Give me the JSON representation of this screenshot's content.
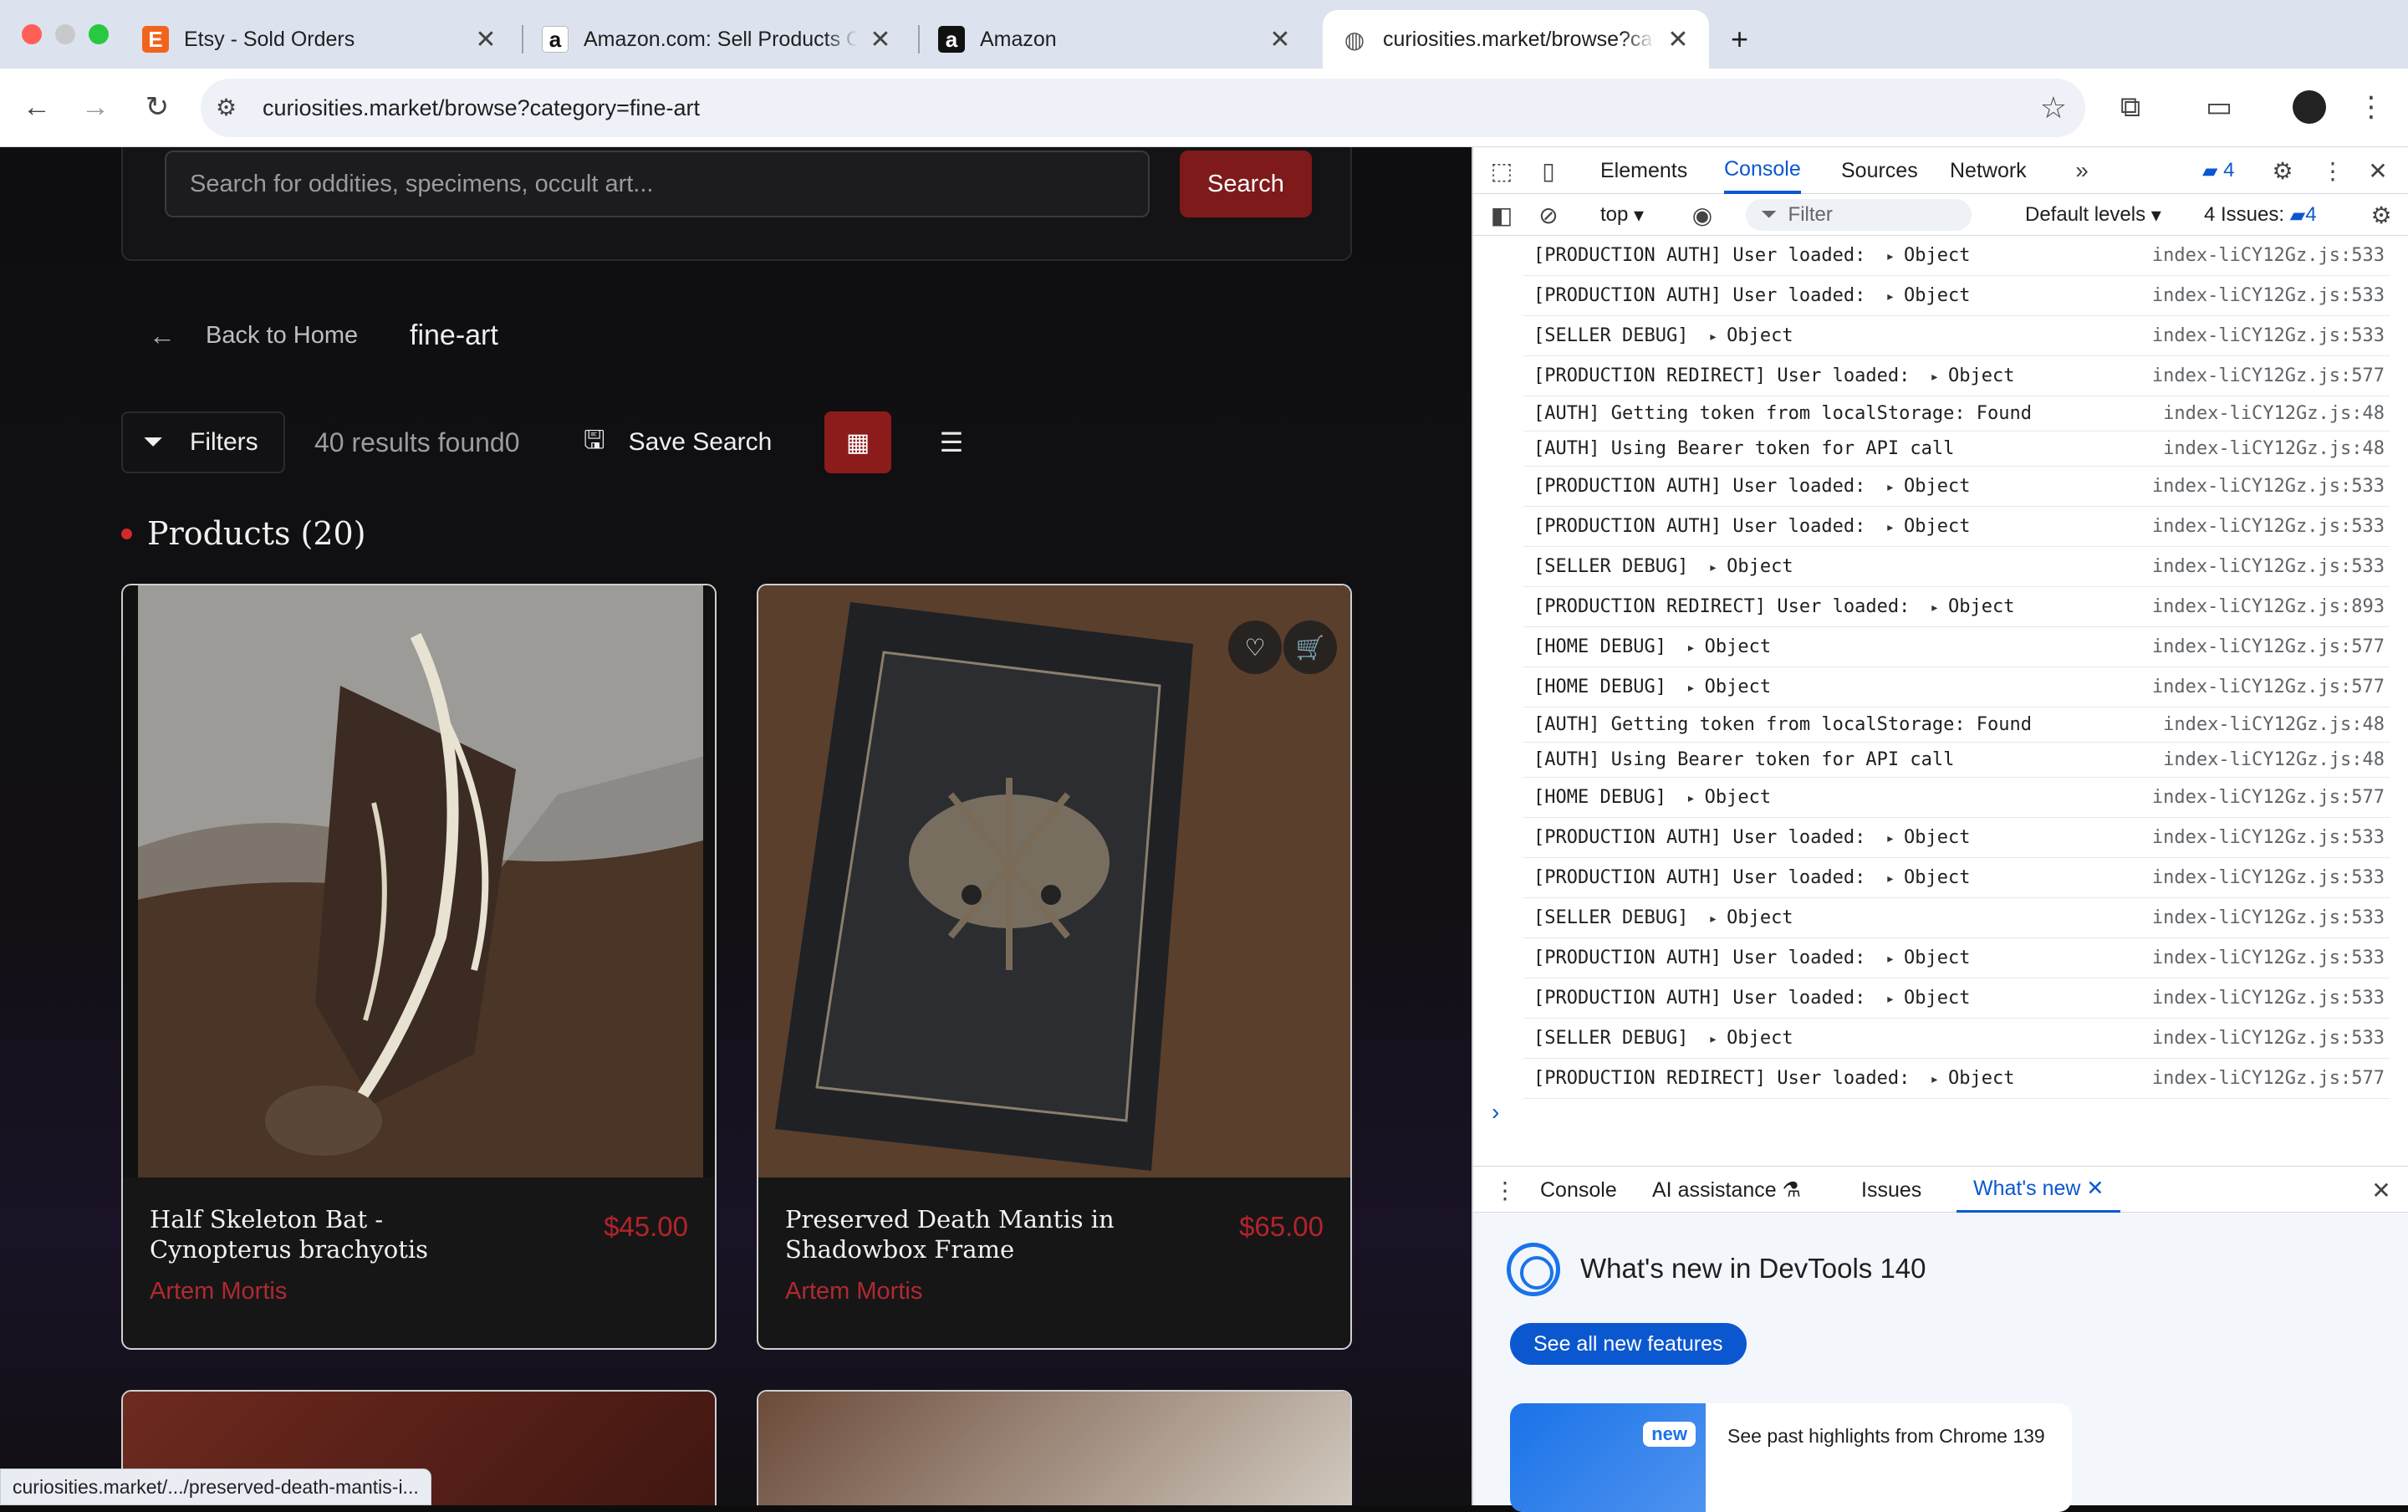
{
  "browser": {
    "tabs": [
      {
        "title": "Etsy - Sold Orders",
        "favicon": "E"
      },
      {
        "title": "Amazon.com: Sell Products Online",
        "favicon": "a"
      },
      {
        "title": "Amazon",
        "favicon": "a"
      },
      {
        "title": "curiosities.market/browse?category=fine-art",
        "favicon": "globe"
      }
    ],
    "new_tab": "+",
    "url": "curiosities.market/browse?category=fine-art",
    "status_url": "curiosities.market/.../preserved-death-mantis-i..."
  },
  "page": {
    "search_placeholder": "Search for oddities, specimens, occult art...",
    "search_button": "Search",
    "back_label": "Back to Home",
    "current_category": "fine-art",
    "filters_label": "Filters",
    "results_text": "40 results found0",
    "save_search_label": "Save Search",
    "products_heading": "Products (20)",
    "products": [
      {
        "name": "Half Skeleton Bat - Cynopterus brachyotis",
        "price": "$45.00",
        "seller": "Artem Mortis"
      },
      {
        "name": "Preserved Death Mantis in Shadowbox Frame",
        "price": "$65.00",
        "seller": "Artem Mortis"
      }
    ]
  },
  "devtools": {
    "tabs": [
      "Elements",
      "Console",
      "Sources",
      "Network"
    ],
    "active_tab": "Console",
    "message_count": "4",
    "context": "top",
    "filter_placeholder": "Filter",
    "levels": "Default levels",
    "issues_label": "4 Issues:",
    "issues_count": "4",
    "log": [
      {
        "msg": "[PRODUCTION AUTH] User loaded:",
        "obj": "Object",
        "src": "index-liCY12Gz.js:533"
      },
      {
        "msg": "[PRODUCTION AUTH] User loaded:",
        "obj": "Object",
        "src": "index-liCY12Gz.js:533"
      },
      {
        "msg": "[SELLER DEBUG]",
        "obj": "Object",
        "src": "index-liCY12Gz.js:533"
      },
      {
        "msg": "[PRODUCTION REDIRECT] User loaded:",
        "obj": "Object",
        "src": "index-liCY12Gz.js:577"
      },
      {
        "msg": "[AUTH] Getting token from localStorage: Found",
        "obj": "",
        "src": "index-liCY12Gz.js:48"
      },
      {
        "msg": "[AUTH] Using Bearer token for API call",
        "obj": "",
        "src": "index-liCY12Gz.js:48"
      },
      {
        "msg": "[PRODUCTION AUTH] User loaded:",
        "obj": "Object",
        "src": "index-liCY12Gz.js:533"
      },
      {
        "msg": "[PRODUCTION AUTH] User loaded:",
        "obj": "Object",
        "src": "index-liCY12Gz.js:533"
      },
      {
        "msg": "[SELLER DEBUG]",
        "obj": "Object",
        "src": "index-liCY12Gz.js:533"
      },
      {
        "msg": "[PRODUCTION REDIRECT] User loaded:",
        "obj": "Object",
        "src": "index-liCY12Gz.js:893"
      },
      {
        "msg": "[HOME DEBUG]",
        "obj": "Object",
        "src": "index-liCY12Gz.js:577"
      },
      {
        "msg": "[HOME DEBUG]",
        "obj": "Object",
        "src": "index-liCY12Gz.js:577"
      },
      {
        "msg": "[AUTH] Getting token from localStorage: Found",
        "obj": "",
        "src": "index-liCY12Gz.js:48"
      },
      {
        "msg": "[AUTH] Using Bearer token for API call",
        "obj": "",
        "src": "index-liCY12Gz.js:48"
      },
      {
        "msg": "[HOME DEBUG]",
        "obj": "Object",
        "src": "index-liCY12Gz.js:577"
      },
      {
        "msg": "[PRODUCTION AUTH] User loaded:",
        "obj": "Object",
        "src": "index-liCY12Gz.js:533"
      },
      {
        "msg": "[PRODUCTION AUTH] User loaded:",
        "obj": "Object",
        "src": "index-liCY12Gz.js:533"
      },
      {
        "msg": "[SELLER DEBUG]",
        "obj": "Object",
        "src": "index-liCY12Gz.js:533"
      },
      {
        "msg": "[PRODUCTION AUTH] User loaded:",
        "obj": "Object",
        "src": "index-liCY12Gz.js:533"
      },
      {
        "msg": "[PRODUCTION AUTH] User loaded:",
        "obj": "Object",
        "src": "index-liCY12Gz.js:533"
      },
      {
        "msg": "[SELLER DEBUG]",
        "obj": "Object",
        "src": "index-liCY12Gz.js:533"
      },
      {
        "msg": "[PRODUCTION REDIRECT] User loaded:",
        "obj": "Object",
        "src": "index-liCY12Gz.js:577"
      }
    ],
    "drawer_tabs": [
      "Console",
      "AI assistance",
      "Issues",
      "What's new"
    ],
    "whats_new_title": "What's new in DevTools 140",
    "see_all_button": "See all new features",
    "new_badge": "new",
    "highlights_text": "See past highlights from Chrome 139"
  }
}
